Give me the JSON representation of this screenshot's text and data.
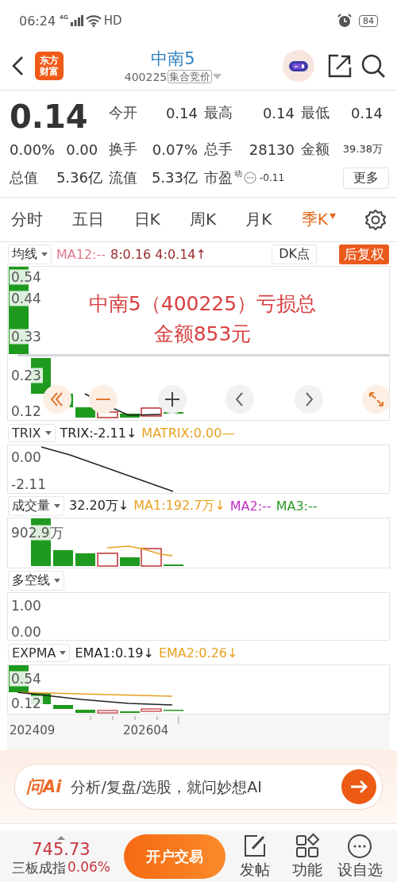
{
  "status_bar": {
    "time": "06:24",
    "network": "4G",
    "hd": "HD",
    "battery": "84"
  },
  "header": {
    "logo": [
      "东方",
      "财富"
    ],
    "title": "中南5",
    "code": "400225",
    "badge": "集合竞价"
  },
  "quote": {
    "price": "0.14",
    "change_pct": "0.00%",
    "change": "0.00",
    "stats": [
      {
        "label": "今开",
        "value": "0.14"
      },
      {
        "label": "最高",
        "value": "0.14"
      },
      {
        "label": "最低",
        "value": "0.14"
      },
      {
        "label": "换手",
        "value": "0.07%"
      },
      {
        "label": "总手",
        "value": "28130"
      },
      {
        "label": "金额",
        "value": "39.38万"
      },
      {
        "label": "总值",
        "value": "5.36亿"
      },
      {
        "label": "流值",
        "value": "5.33亿"
      }
    ],
    "pe": {
      "label": "市盈",
      "sup": "动",
      "value": "-0.11"
    },
    "more": "更多"
  },
  "tabs": [
    {
      "label": "分时",
      "selected": false,
      "has_menu": false
    },
    {
      "label": "五日",
      "selected": false,
      "has_menu": false
    },
    {
      "label": "日K",
      "selected": false,
      "has_menu": false
    },
    {
      "label": "周K",
      "selected": false,
      "has_menu": false
    },
    {
      "label": "月K",
      "selected": false,
      "has_menu": false
    },
    {
      "label": "季K",
      "selected": true,
      "has_menu": true
    }
  ],
  "main_chart": {
    "selector": "均线",
    "legends": [
      {
        "text": "MA12:--",
        "color": "#e0788a"
      },
      {
        "text": "8:0.16 4:0.14↑",
        "color": "#9a2a2a"
      }
    ],
    "dk_button": "DK点",
    "adjust_button": "后复权",
    "axis_labels": [
      "0.54",
      "0.44",
      "0.33",
      "0.23",
      "0.12"
    ],
    "annotation": "中南5（400225）亏损总金额853元"
  },
  "indicators": [
    {
      "kind": "trix",
      "selector": "TRIX",
      "legends": [
        {
          "text": "TRIX:-2.11↓",
          "color": "#222222"
        },
        {
          "text": "MATRIX:0.00—",
          "color": "#e8a020"
        }
      ],
      "axis_labels": [
        "0.00",
        "-2.11"
      ]
    },
    {
      "kind": "volume",
      "selector": "成交量",
      "legends": [
        {
          "text": "32.20万↓",
          "color": "#222222"
        },
        {
          "text": "MA1:192.7万↓",
          "color": "#e8a020"
        },
        {
          "text": "MA2:--",
          "color": "#c030c0"
        },
        {
          "text": "MA3:--",
          "color": "#2a9a2a"
        }
      ],
      "axis_labels": [
        "902.9万"
      ]
    },
    {
      "kind": "long_short",
      "selector": "多空线",
      "axis_labels": [
        "1.00",
        "0.00"
      ]
    },
    {
      "kind": "expma",
      "selector": "EXPMA",
      "legends": [
        {
          "text": "EMA1:0.19↓",
          "color": "#222222"
        },
        {
          "text": "EMA2:0.26↓",
          "color": "#e8a020"
        }
      ],
      "axis_labels": [
        "0.54",
        "0.12"
      ]
    }
  ],
  "x_axis": [
    "202409",
    "202604"
  ],
  "ai_bar": {
    "logo": "问Ai",
    "placeholder": "分析/复盘/选股，就问妙想AI"
  },
  "bottom_bar": {
    "index_value": "745.73",
    "index_name": "三板成指",
    "index_change": "0.06%",
    "trade_button": "开户交易",
    "actions": [
      {
        "kind": "post",
        "label": "发帖"
      },
      {
        "kind": "functions",
        "label": "功能"
      },
      {
        "kind": "watchlist",
        "label": "设自选"
      }
    ]
  }
}
